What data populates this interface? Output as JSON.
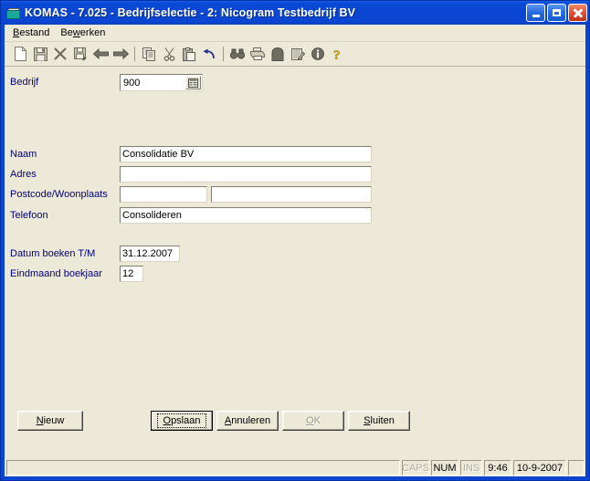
{
  "window": {
    "title": "KOMAS  -  7.025 - Bedrijfselectie - 2: Nicogram Testbedrijf BV",
    "icon": "app-folder-icon",
    "controls": {
      "minimize": "Minimize",
      "maximize": "Maximize",
      "close": "Close"
    }
  },
  "menu": {
    "items": [
      {
        "label": "Bestand",
        "mnemonic": "B"
      },
      {
        "label": "Bewerken",
        "mnemonic": "w"
      }
    ]
  },
  "toolbar": {
    "buttons": [
      {
        "name": "new-icon",
        "title": "Nieuw"
      },
      {
        "name": "save-icon",
        "title": "Opslaan"
      },
      {
        "name": "delete-icon",
        "title": "Verwijderen"
      },
      {
        "name": "save-as-icon",
        "title": "Opslaan als"
      },
      {
        "name": "back-arrow-icon",
        "title": "Vorige"
      },
      {
        "name": "forward-arrow-icon",
        "title": "Volgende"
      },
      {
        "name": "separator-1",
        "title": ""
      },
      {
        "name": "copy-icon",
        "title": "Kopieren"
      },
      {
        "name": "cut-icon",
        "title": "Knippen"
      },
      {
        "name": "paste-icon",
        "title": "Plakken"
      },
      {
        "name": "undo-icon",
        "title": "Ongedaan maken"
      },
      {
        "name": "separator-2",
        "title": ""
      },
      {
        "name": "find-icon",
        "title": "Zoeken"
      },
      {
        "name": "print-icon",
        "title": "Afdrukken"
      },
      {
        "name": "print-preview-icon",
        "title": "Afdrukvoorbeeld"
      },
      {
        "name": "edit-icon",
        "title": "Bewerken"
      },
      {
        "name": "info-icon",
        "title": "Info"
      },
      {
        "name": "help-icon",
        "title": "Help"
      }
    ]
  },
  "form": {
    "company": {
      "label": "Bedrijf",
      "value": "900",
      "lookup_icon": "list-lookup-icon"
    },
    "fields": [
      {
        "label": "Naam",
        "value": "Consolidatie BV"
      },
      {
        "label": "Adres",
        "value": ""
      },
      {
        "label": "Postcode/Woonplaats",
        "value": "",
        "value2": ""
      },
      {
        "label": "Telefoon",
        "value": "Consolideren"
      }
    ],
    "dates": [
      {
        "label": "Datum boeken T/M",
        "value": "31.12.2007"
      },
      {
        "label": "Eindmaand boekjaar",
        "value": "12"
      }
    ]
  },
  "buttons": {
    "new": {
      "label": "Nieuw",
      "mnemonic": "N",
      "state": "enabled"
    },
    "save": {
      "label": "Opslaan",
      "mnemonic": "O",
      "state": "default-focused"
    },
    "cancel": {
      "label": "Annuleren",
      "mnemonic": "A",
      "state": "enabled"
    },
    "ok": {
      "label": "OK",
      "mnemonic": "O",
      "state": "disabled"
    },
    "close": {
      "label": "Sluiten",
      "mnemonic": "S",
      "state": "enabled"
    }
  },
  "statusbar": {
    "message": "",
    "caps": "CAPS",
    "num": "NUM",
    "ins": "INS",
    "time": "9:46",
    "date": "10-9-2007",
    "trailing": ""
  },
  "colors": {
    "titlebar": "#0A46D2",
    "face": "#ECE9D8",
    "label": "#000080",
    "close_button": "#C0301A"
  }
}
